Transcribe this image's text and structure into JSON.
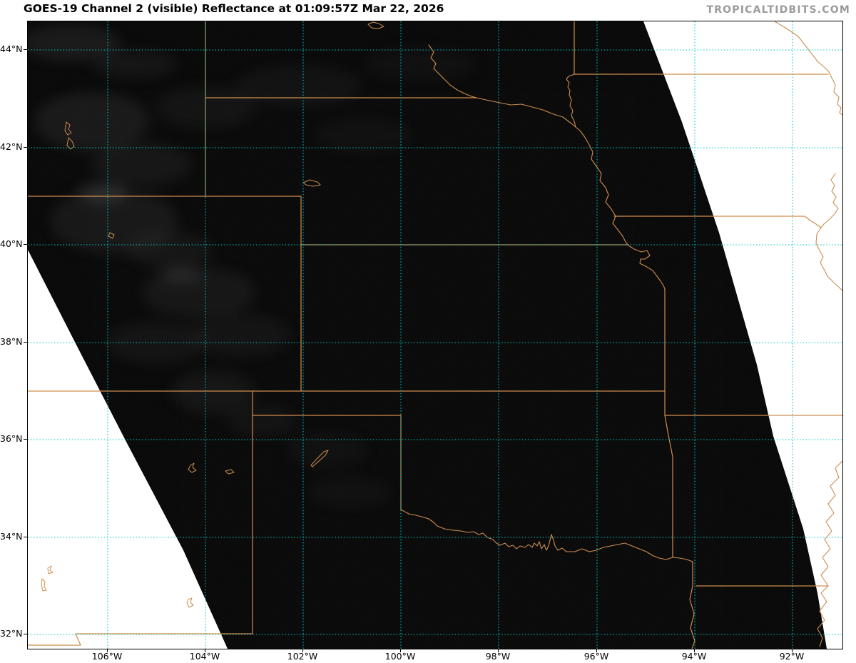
{
  "title": "GOES-19 Channel 2 (visible) Reflectance at 01:09:57Z Mar 22, 2026",
  "watermark": "TROPICALTIDBITS.COM",
  "satellite": {
    "name": "GOES-19",
    "channel": "Channel 2 (visible)",
    "product": "Reflectance",
    "time": "01:09:57Z",
    "date": "Mar 22, 2026"
  },
  "axes": {
    "lat": [
      {
        "label": "44°N"
      },
      {
        "label": "42°N"
      },
      {
        "label": "40°N"
      },
      {
        "label": "38°N"
      },
      {
        "label": "36°N"
      },
      {
        "label": "34°N"
      },
      {
        "label": "32°N"
      }
    ],
    "lon": [
      {
        "label": "106°W"
      },
      {
        "label": "104°W"
      },
      {
        "label": "102°W"
      },
      {
        "label": "100°W"
      },
      {
        "label": "98°W"
      },
      {
        "label": "96°W"
      },
      {
        "label": "94°W"
      },
      {
        "label": "92°W"
      }
    ]
  },
  "colors": {
    "gridline": "#00c8c8",
    "state_border": "#cd8d4e",
    "satellite_dark": "#070707",
    "watermark": "#9b9b9b",
    "frame": "#000000",
    "background": "#ffffff"
  }
}
